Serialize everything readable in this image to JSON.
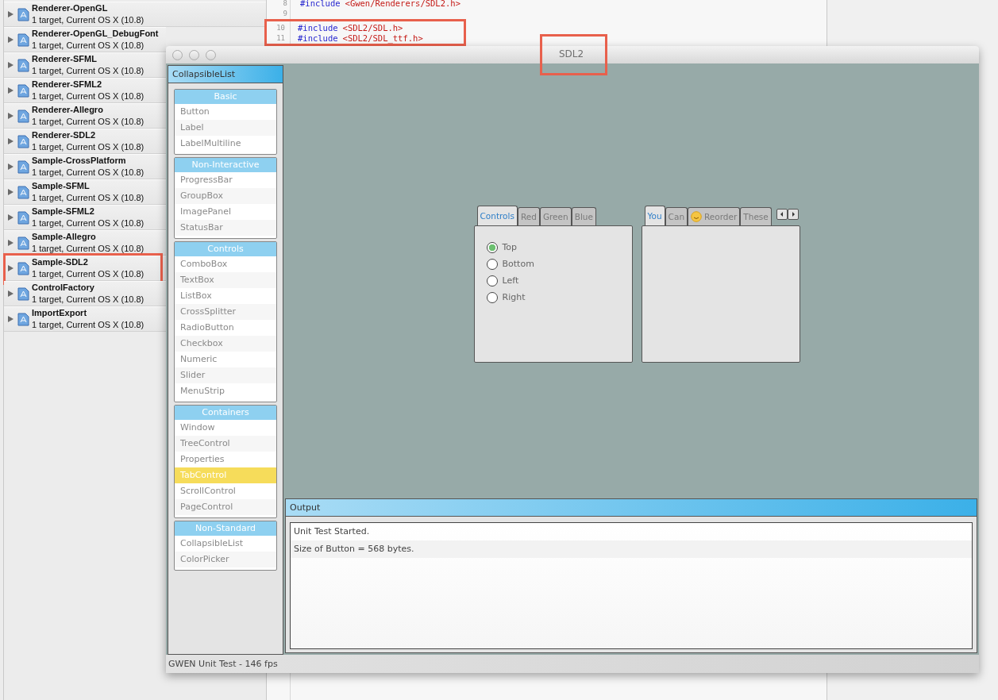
{
  "projects": [
    {
      "name": "Renderer-OpenGL",
      "detail": "1 target, Current OS X (10.8)",
      "highlighted": false
    },
    {
      "name": "Renderer-OpenGL_DebugFont",
      "detail": "1 target, Current OS X (10.8)",
      "highlighted": false
    },
    {
      "name": "Renderer-SFML",
      "detail": "1 target, Current OS X (10.8)",
      "highlighted": false
    },
    {
      "name": "Renderer-SFML2",
      "detail": "1 target, Current OS X (10.8)",
      "highlighted": false
    },
    {
      "name": "Renderer-Allegro",
      "detail": "1 target, Current OS X (10.8)",
      "highlighted": false
    },
    {
      "name": "Renderer-SDL2",
      "detail": "1 target, Current OS X (10.8)",
      "highlighted": false
    },
    {
      "name": "Sample-CrossPlatform",
      "detail": "1 target, Current OS X (10.8)",
      "highlighted": false
    },
    {
      "name": "Sample-SFML",
      "detail": "1 target, Current OS X (10.8)",
      "highlighted": false
    },
    {
      "name": "Sample-SFML2",
      "detail": "1 target, Current OS X (10.8)",
      "highlighted": false
    },
    {
      "name": "Sample-Allegro",
      "detail": "1 target, Current OS X (10.8)",
      "highlighted": false
    },
    {
      "name": "Sample-SDL2",
      "detail": "1 target, Current OS X (10.8)",
      "highlighted": true
    },
    {
      "name": "ControlFactory",
      "detail": "1 target, Current OS X (10.8)",
      "highlighted": false
    },
    {
      "name": "ImportExport",
      "detail": "1 target, Current OS X (10.8)",
      "highlighted": false
    }
  ],
  "code_lines": [
    {
      "number": "8",
      "directive": "#include",
      "path": "<Gwen/Renderers/SDL2.h>",
      "highlighted": false
    },
    {
      "number": "9",
      "highlighted": false
    },
    {
      "number": "10",
      "directive": "#include",
      "path": "<SDL2/SDL.h>",
      "highlighted": true
    },
    {
      "number": "11",
      "directive": "#include",
      "path": "<SDL2/SDL_ttf.h>",
      "highlighted": true
    }
  ],
  "window": {
    "title": "SDL2",
    "title_highlighted": true,
    "sidebar": {
      "title": "CollapsibleList",
      "categories": [
        {
          "title": "Basic",
          "items": [
            {
              "label": "Button",
              "selected": false
            },
            {
              "label": "Label",
              "selected": false
            },
            {
              "label": "LabelMultiline",
              "selected": false
            }
          ]
        },
        {
          "title": "Non-Interactive",
          "items": [
            {
              "label": "ProgressBar",
              "selected": false
            },
            {
              "label": "GroupBox",
              "selected": false
            },
            {
              "label": "ImagePanel",
              "selected": false
            },
            {
              "label": "StatusBar",
              "selected": false
            }
          ]
        },
        {
          "title": "Controls",
          "items": [
            {
              "label": "ComboBox",
              "selected": false
            },
            {
              "label": "TextBox",
              "selected": false
            },
            {
              "label": "ListBox",
              "selected": false
            },
            {
              "label": "CrossSplitter",
              "selected": false
            },
            {
              "label": "RadioButton",
              "selected": false
            },
            {
              "label": "Checkbox",
              "selected": false
            },
            {
              "label": "Numeric",
              "selected": false
            },
            {
              "label": "Slider",
              "selected": false
            },
            {
              "label": "MenuStrip",
              "selected": false
            }
          ]
        },
        {
          "title": "Containers",
          "items": [
            {
              "label": "Window",
              "selected": false
            },
            {
              "label": "TreeControl",
              "selected": false
            },
            {
              "label": "Properties",
              "selected": false
            },
            {
              "label": "TabControl",
              "selected": true
            },
            {
              "label": "ScrollControl",
              "selected": false
            },
            {
              "label": "PageControl",
              "selected": false
            }
          ]
        },
        {
          "title": "Non-Standard",
          "items": [
            {
              "label": "CollapsibleList",
              "selected": false
            },
            {
              "label": "ColorPicker",
              "selected": false
            }
          ]
        }
      ]
    },
    "tab_controls": [
      {
        "tabs": [
          {
            "label": "Controls",
            "selected": true
          },
          {
            "label": "Red",
            "selected": false
          },
          {
            "label": "Green",
            "selected": false
          },
          {
            "label": "Blue",
            "selected": false
          }
        ],
        "radios": [
          {
            "label": "Top",
            "selected": true
          },
          {
            "label": "Bottom",
            "selected": false
          },
          {
            "label": "Left",
            "selected": false
          },
          {
            "label": "Right",
            "selected": false
          }
        ]
      },
      {
        "tabs": [
          {
            "label": "You",
            "selected": true
          },
          {
            "label": "Can",
            "selected": false
          },
          {
            "label": "Reorder",
            "selected": false,
            "kind": "icon"
          },
          {
            "label": "These",
            "selected": false
          }
        ],
        "scroll_buttons": true
      }
    ],
    "output": {
      "title": "Output",
      "lines": [
        "Unit Test Started.",
        "Size of Button = 568 bytes."
      ]
    },
    "status_bar": "GWEN Unit Test - 146 fps"
  }
}
